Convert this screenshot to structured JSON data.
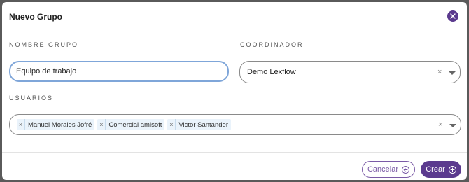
{
  "modal": {
    "title": "Nuevo Grupo"
  },
  "form": {
    "nombre_label": "NOMBRE GRUPO",
    "nombre_value": "Equipo de trabajo",
    "coordinador_label": "COORDINADOR",
    "coordinador_value": "Demo Lexflow",
    "usuarios_label": "USUARIOS",
    "usuarios": [
      "Manuel Morales Jofré",
      "Comercial amisoft",
      "Victor Santander"
    ]
  },
  "footer": {
    "cancel_label": "Cancelar",
    "create_label": "Crear"
  },
  "colors": {
    "accent": "#5b3a8e",
    "focus_border": "#7fa6d9",
    "tag_bg": "#eaf3fb"
  },
  "icons": {
    "close": "close-icon",
    "cancel": "arrow-left-circle-icon",
    "create": "plus-circle-icon"
  }
}
